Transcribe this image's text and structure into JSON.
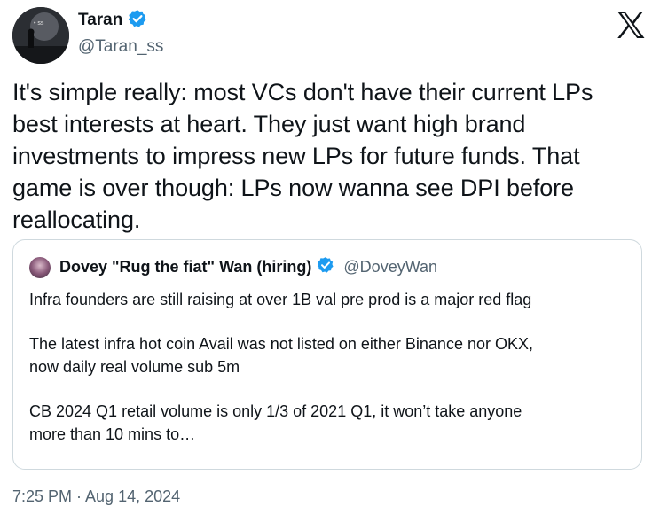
{
  "author": {
    "display_name": "Taran",
    "handle": "@Taran_ss",
    "avatar_icon": "profile-photo",
    "verified_icon": "verified-badge-icon",
    "verified_color": "#1d9bf0"
  },
  "platform": {
    "logo_icon": "x-logo-icon"
  },
  "tweet": {
    "lines": [
      "It's simple really: most VCs don't have their current LPs",
      "best interests at heart. They just want high brand",
      "investments to impress new LPs for future funds. That",
      "game is over though: LPs now wanna see DPI before",
      "reallocating."
    ]
  },
  "quote": {
    "display_name": "Dovey \"Rug the fiat\" Wan (hiring)",
    "handle": "@DoveyWan",
    "verified_icon": "verified-badge-icon",
    "paragraphs": [
      {
        "lines": [
          "Infra founders are still raising at over 1B val pre prod is a major red flag"
        ]
      },
      {
        "lines": [
          "The latest infra hot coin Avail was not listed on either Binance nor OKX,",
          "now daily real volume sub 5m"
        ]
      },
      {
        "lines": [
          "CB 2024 Q1 retail volume is only 1/3 of 2021 Q1, it won’t take anyone",
          "more than 10 mins to…"
        ]
      }
    ]
  },
  "timestamp": "7:25 PM · Aug 14, 2024",
  "colors": {
    "text_primary": "#0f1419",
    "text_secondary": "#536471",
    "border": "#cfd9de",
    "accent": "#1d9bf0"
  }
}
